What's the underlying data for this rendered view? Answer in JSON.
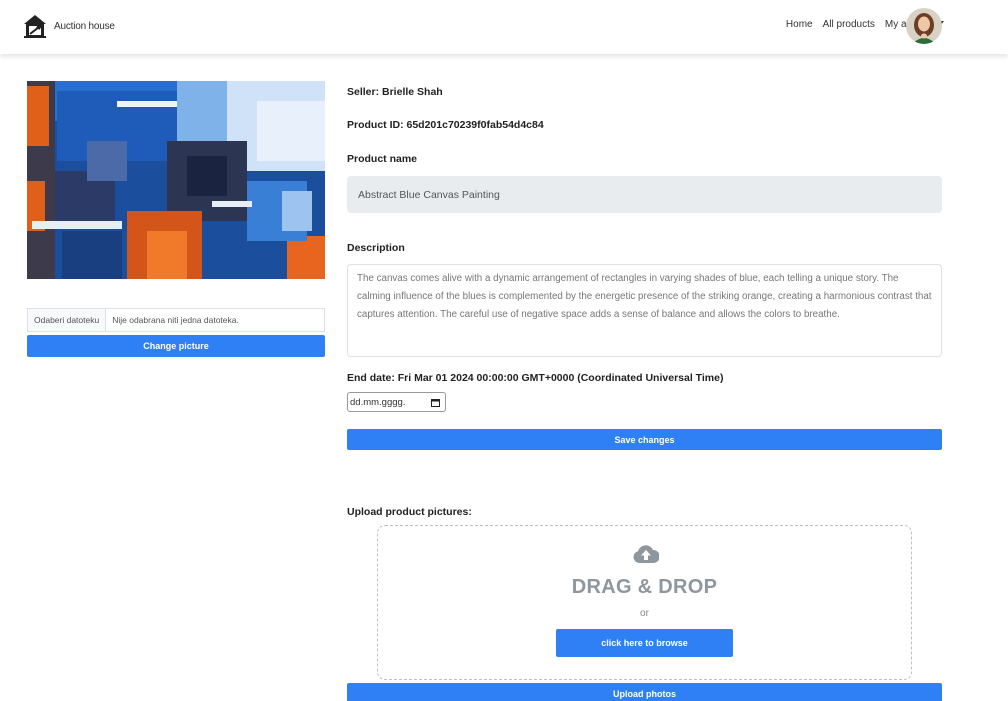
{
  "navbar": {
    "brand": "Auction house",
    "links": {
      "home": "Home",
      "all_products": "All products",
      "my_account": "My account"
    }
  },
  "left": {
    "file_button": "Odaberi datoteku",
    "file_status": "Nije odabrana niti jedna datoteka.",
    "change_picture": "Change picture"
  },
  "product": {
    "seller": "Seller: Brielle Shah",
    "product_id": "Product ID: 65d201c70239f0fab54d4c84",
    "name_label": "Product name",
    "name_value": "Abstract Blue Canvas Painting",
    "description_label": "Description",
    "description": "The canvas comes alive with a dynamic arrangement of rectangles in varying shades of blue, each telling a unique story. The calming influence of the blues is complemented by the energetic presence of the striking orange, creating a harmonious contrast that captures attention. The careful use of negative space adds a sense of balance and allows the colors to breathe.",
    "end_date": "End date: Fri Mar 01 2024 00:00:00 GMT+0000 (Coordinated Universal Time)",
    "date_placeholder": "dd.mm.gggg.",
    "save_changes": "Save changes"
  },
  "upload": {
    "label": "Upload product pictures:",
    "drag_drop": "DRAG & DROP",
    "or": "or",
    "browse": "click here to browse",
    "upload_photos": "Upload photos"
  },
  "colors": {
    "primary": "#2f80f5",
    "input_bg": "#e9ecef"
  }
}
